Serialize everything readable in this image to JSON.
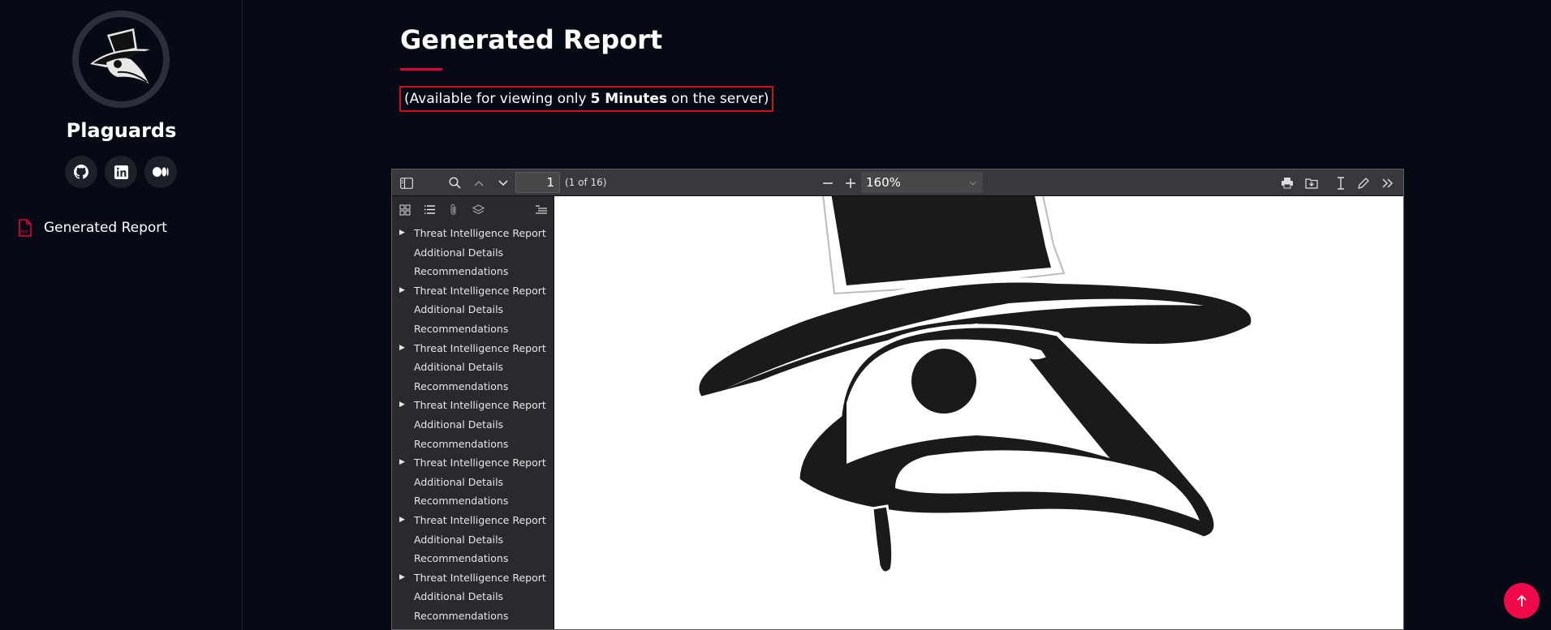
{
  "sidebar": {
    "brand": "Plaguards",
    "socials": [
      "github-icon",
      "linkedin-icon",
      "medium-icon"
    ],
    "nav": [
      {
        "label": "Generated Report",
        "icon": "pdf-file-icon"
      }
    ]
  },
  "main": {
    "title": "Generated Report",
    "notice": {
      "before": "(Available for viewing only",
      "bold": "5 Minutes",
      "after": "on the server)"
    }
  },
  "viewer": {
    "page_number": "1",
    "page_count": "(1 of 16)",
    "zoom": "160%",
    "outline": [
      {
        "label": "Threat Intelligence Report",
        "expandable": true
      },
      {
        "label": "Additional Details",
        "expandable": false
      },
      {
        "label": "Recommendations",
        "expandable": false
      },
      {
        "label": "Threat Intelligence Report",
        "expandable": true
      },
      {
        "label": "Additional Details",
        "expandable": false
      },
      {
        "label": "Recommendations",
        "expandable": false
      },
      {
        "label": "Threat Intelligence Report",
        "expandable": true
      },
      {
        "label": "Additional Details",
        "expandable": false
      },
      {
        "label": "Recommendations",
        "expandable": false
      },
      {
        "label": "Threat Intelligence Report",
        "expandable": true
      },
      {
        "label": "Additional Details",
        "expandable": false
      },
      {
        "label": "Recommendations",
        "expandable": false
      },
      {
        "label": "Threat Intelligence Report",
        "expandable": true
      },
      {
        "label": "Additional Details",
        "expandable": false
      },
      {
        "label": "Recommendations",
        "expandable": false
      },
      {
        "label": "Threat Intelligence Report",
        "expandable": true
      },
      {
        "label": "Additional Details",
        "expandable": false
      },
      {
        "label": "Recommendations",
        "expandable": false
      },
      {
        "label": "Threat Intelligence Report",
        "expandable": true
      },
      {
        "label": "Additional Details",
        "expandable": false
      },
      {
        "label": "Recommendations",
        "expandable": false
      }
    ]
  },
  "colors": {
    "accent": "#e4003a",
    "background": "#050a14",
    "scroll_button": "#f0094a"
  }
}
